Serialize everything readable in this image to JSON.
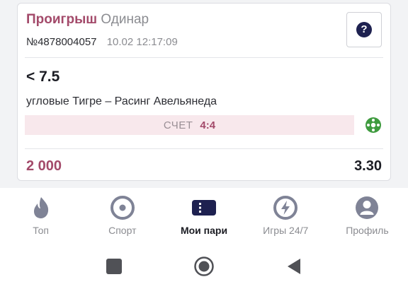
{
  "bet": {
    "status": "Проигрыш",
    "type": "Одинар",
    "id": "№4878004057",
    "datetime": "10.02 12:17:09",
    "help_label": "?",
    "selection": "< 7.5",
    "market": "угловые Тигре – Расинг Авельянеда",
    "score_label": "СЧЕТ",
    "score_value": "4:4",
    "stake": "2 000",
    "odds": "3.30"
  },
  "nav": {
    "items": [
      {
        "label": "Топ",
        "icon": "flame-icon"
      },
      {
        "label": "Спорт",
        "icon": "target-icon"
      },
      {
        "label": "Мои пари",
        "icon": "ticket-icon",
        "active": true
      },
      {
        "label": "Игры 24/7",
        "icon": "lightning-icon"
      },
      {
        "label": "Профиль",
        "icon": "profile-icon"
      }
    ]
  },
  "colors": {
    "lost": "#a34a6a",
    "accent": "#1e2150",
    "muted": "#8b8c91",
    "score_bg": "#f8e8ec",
    "ball": "#3f9b3f"
  }
}
